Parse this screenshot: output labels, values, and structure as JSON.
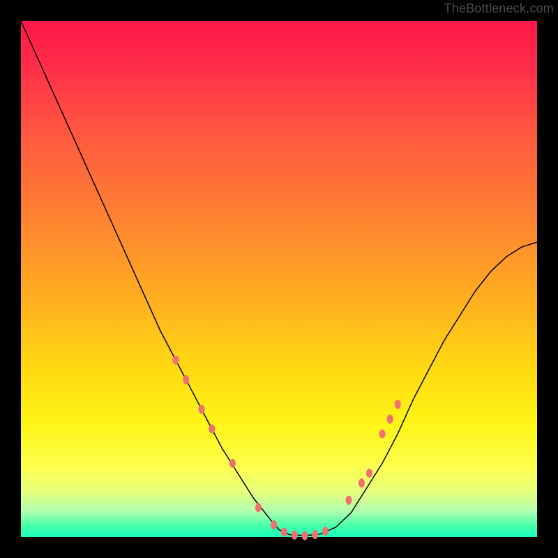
{
  "watermark": {
    "text": "TheBottleneck.com"
  },
  "colors": {
    "marker": "#f07070",
    "curve": "#000000",
    "frame_bg_top": "#ff1848",
    "frame_bg_bottom": "#1affc0",
    "page_bg": "#000000"
  },
  "chart_data": {
    "type": "line",
    "title": "",
    "xlabel": "",
    "ylabel": "",
    "xlim": [
      0,
      100
    ],
    "ylim": [
      0,
      105
    ],
    "grid": false,
    "series": [
      {
        "name": "bottleneck-curve",
        "x": [
          0,
          3,
          6,
          9,
          12,
          15,
          18,
          21,
          24,
          27,
          30,
          33,
          36,
          39,
          42,
          45,
          48,
          50,
          52,
          55,
          58,
          61,
          64,
          67,
          70,
          73,
          76,
          79,
          82,
          85,
          88,
          91,
          94,
          97,
          100
        ],
        "y": [
          105,
          98,
          91,
          84,
          77,
          70,
          63,
          56,
          49,
          42,
          36,
          30,
          24,
          18,
          13,
          8,
          4,
          1.5,
          0.5,
          0.3,
          0.6,
          2,
          5,
          10,
          15,
          21,
          28,
          34,
          40,
          45,
          50,
          54,
          57,
          59,
          60
        ]
      }
    ],
    "markers": [
      {
        "x": 30,
        "y": 36
      },
      {
        "x": 32,
        "y": 32
      },
      {
        "x": 35,
        "y": 26
      },
      {
        "x": 37,
        "y": 22
      },
      {
        "x": 41,
        "y": 15
      },
      {
        "x": 46,
        "y": 6
      },
      {
        "x": 49,
        "y": 2.5
      },
      {
        "x": 51,
        "y": 1
      },
      {
        "x": 53,
        "y": 0.4
      },
      {
        "x": 55,
        "y": 0.3
      },
      {
        "x": 57,
        "y": 0.5
      },
      {
        "x": 59,
        "y": 1.2
      },
      {
        "x": 63.5,
        "y": 7.5
      },
      {
        "x": 66,
        "y": 11
      },
      {
        "x": 67.5,
        "y": 13
      },
      {
        "x": 70,
        "y": 21
      },
      {
        "x": 71.5,
        "y": 24
      },
      {
        "x": 73,
        "y": 27
      }
    ],
    "marker_style": {
      "shape": "pill",
      "rx": 4.5,
      "ry": 6.5
    }
  }
}
